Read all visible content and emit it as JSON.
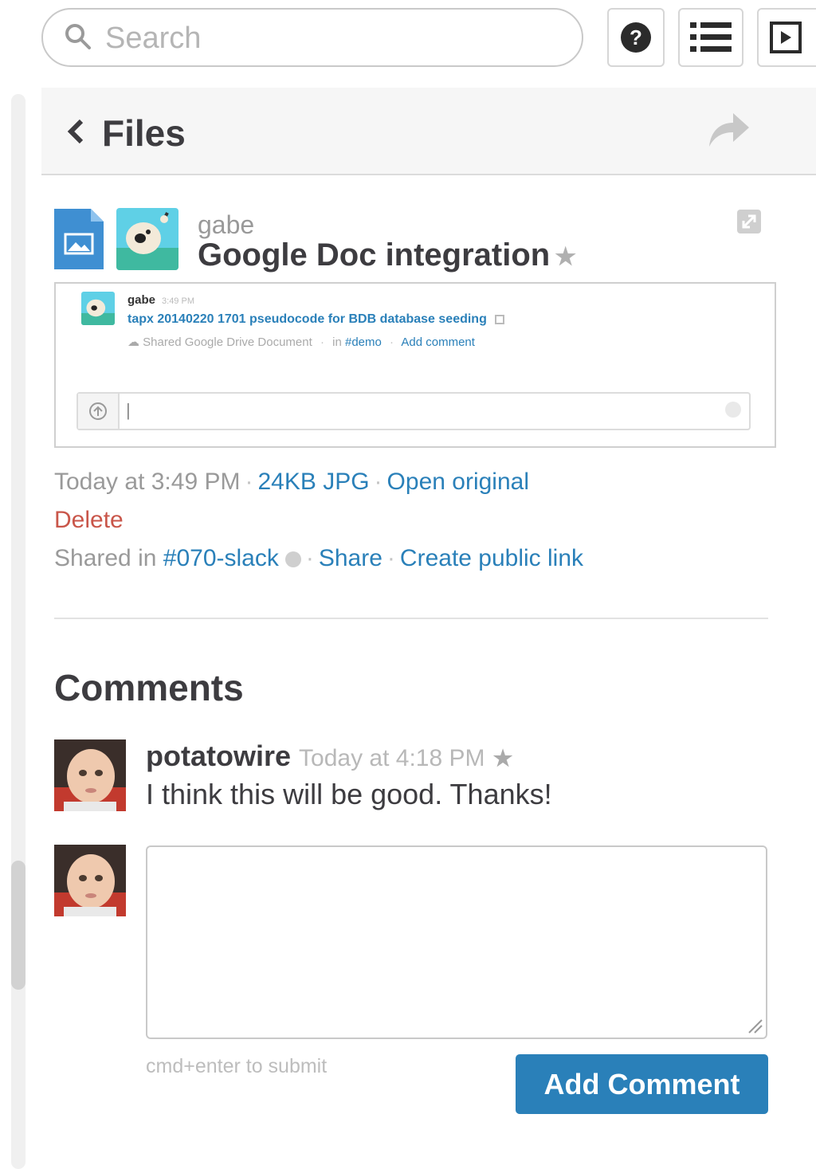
{
  "search": {
    "placeholder": "Search"
  },
  "toolbar": {
    "help_icon": "help-icon",
    "list_icon": "list-icon",
    "flexpane_icon": "flexpane-icon"
  },
  "header": {
    "title": "Files"
  },
  "file": {
    "uploader": "gabe",
    "title": "Google Doc integration",
    "timestamp": "Today at 3:49 PM",
    "size_type": "24KB JPG",
    "open_original": "Open original",
    "delete": "Delete",
    "shared_in_label": "Shared in",
    "channel": "#070-slack",
    "share": "Share",
    "public_link": "Create public link"
  },
  "preview": {
    "user": "gabe",
    "time": "3:49 PM",
    "doc_title": "tapx 20140220 1701 pseudocode for BDB database seeding",
    "meta_prefix": "Shared Google Drive Document",
    "meta_in": "in",
    "meta_channel": "#demo",
    "meta_add_comment": "Add comment"
  },
  "comments": {
    "heading": "Comments",
    "items": [
      {
        "author": "potatowire",
        "time": "Today at 4:18 PM",
        "text": "I think this will be good. Thanks!"
      }
    ],
    "submit_hint": "cmd+enter to submit",
    "add_button": "Add Comment"
  },
  "colors": {
    "link": "#2a80b9",
    "danger": "#c0392b",
    "button": "#2a80b9",
    "header_bg": "#f6f6f6"
  }
}
